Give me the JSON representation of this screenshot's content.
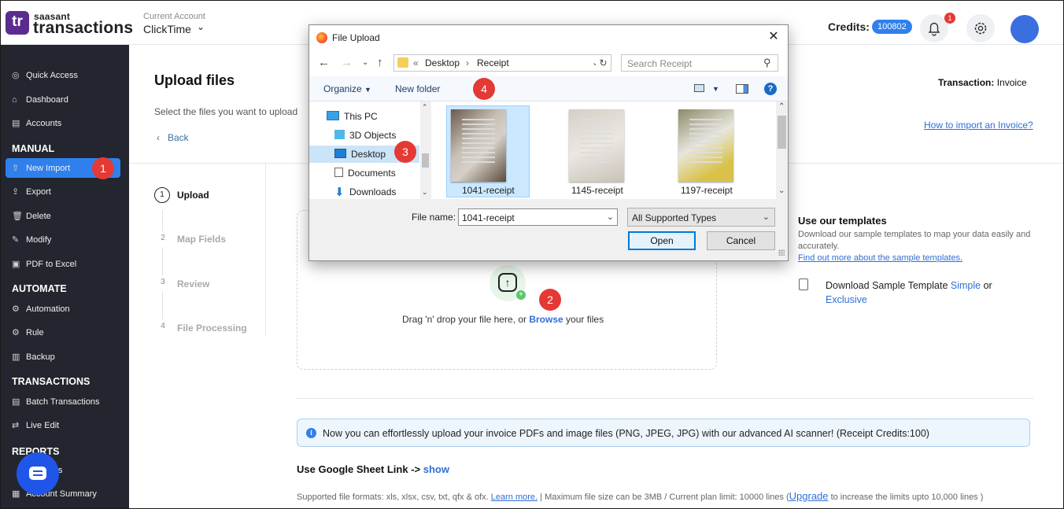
{
  "header": {
    "brand_top": "saasant",
    "brand_main": "transactions",
    "logo_text": "tr",
    "account_label": "Current Account",
    "account_name": "ClickTime",
    "credits_label": "Credits:",
    "credits_value": "100802",
    "notification_count": "1"
  },
  "sidebar": {
    "items": [
      {
        "label": "Quick Access",
        "icon": "quick-access-icon"
      },
      {
        "label": "Dashboard",
        "icon": "home-icon"
      },
      {
        "label": "Accounts",
        "icon": "accounts-icon"
      },
      {
        "label": "New Import",
        "icon": "import-icon"
      },
      {
        "label": "Export",
        "icon": "export-icon"
      },
      {
        "label": "Delete",
        "icon": "trash-icon"
      },
      {
        "label": "Modify",
        "icon": "edit-icon"
      },
      {
        "label": "PDF to Excel",
        "icon": "pdf-icon"
      },
      {
        "label": "Automation",
        "icon": "automation-icon"
      },
      {
        "label": "Rule",
        "icon": "rule-icon"
      },
      {
        "label": "Backup",
        "icon": "backup-icon"
      },
      {
        "label": "Batch Transactions",
        "icon": "batch-icon"
      },
      {
        "label": "Live Edit",
        "icon": "live-edit-icon"
      },
      {
        "label": "ts",
        "icon": "reports-icon"
      },
      {
        "label": "Account Summary",
        "icon": "summary-icon"
      }
    ],
    "sections": [
      "MANUAL",
      "AUTOMATE",
      "TRANSACTIONS",
      "REPORTS"
    ],
    "active_item": "New Import",
    "accent": "#2f80ed",
    "background": "#23262e"
  },
  "annotations": [
    "1",
    "2",
    "3",
    "4"
  ],
  "main": {
    "title": "Upload files",
    "subtitle": "Select the files you want to upload",
    "back": "Back",
    "transaction_label": "Transaction:",
    "transaction_value": "Invoice",
    "howto_link": "How to import an Invoice?",
    "steps": [
      {
        "num": "1",
        "label": "Upload",
        "active": true
      },
      {
        "num": "2",
        "label": "Map Fields",
        "active": false
      },
      {
        "num": "3",
        "label": "Review",
        "active": false
      },
      {
        "num": "4",
        "label": "File Processing",
        "active": false
      }
    ],
    "drop": {
      "prefix": "Drag 'n' drop your file here, or",
      "link": "Browse",
      "suffix": "your files"
    },
    "templates": {
      "title": "Use our templates",
      "desc": "Download our sample templates to map your data easily and accurately.",
      "link": "Find out more about the sample templates.",
      "download_prefix": "Download Sample Template",
      "simple": "Simple",
      "or": "or",
      "exclusive": "Exclusive"
    },
    "info": "Now you can effortlessly upload your invoice PDFs and image files (PNG, JPEG, JPG) with our advanced AI scanner! (Receipt Credits:100)",
    "gsheet_label": "Use Google Sheet Link ->",
    "gsheet_link": "show",
    "formats_prefix": "Supported file formats: xls, xlsx, csv, txt, qfx & ofx.",
    "formats_learn": "Learn more.",
    "formats_mid": "|   Maximum file size can be 3MB / Current plan limit: 10000 lines (",
    "formats_upgrade": "Upgrade",
    "formats_suffix": "to increase the limits upto 10,000 lines )"
  },
  "dialog": {
    "title": "File Upload",
    "path": [
      "«",
      "Desktop",
      "›",
      "Receipt"
    ],
    "search_placeholder": "Search Receipt",
    "organize": "Organize",
    "new_folder": "New folder",
    "nav_items": [
      {
        "label": "This PC",
        "icon": "pc-icon"
      },
      {
        "label": "3D Objects",
        "icon": "cube-icon"
      },
      {
        "label": "Desktop",
        "icon": "desktop-icon"
      },
      {
        "label": "Documents",
        "icon": "documents-icon"
      },
      {
        "label": "Downloads",
        "icon": "download-icon"
      }
    ],
    "files": [
      "1041-receipt",
      "1145-receipt",
      "1197-receipt"
    ],
    "file_name_label": "File name:",
    "file_name_value": "1041-receipt",
    "file_type": "All Supported Types",
    "open": "Open",
    "cancel": "Cancel"
  }
}
